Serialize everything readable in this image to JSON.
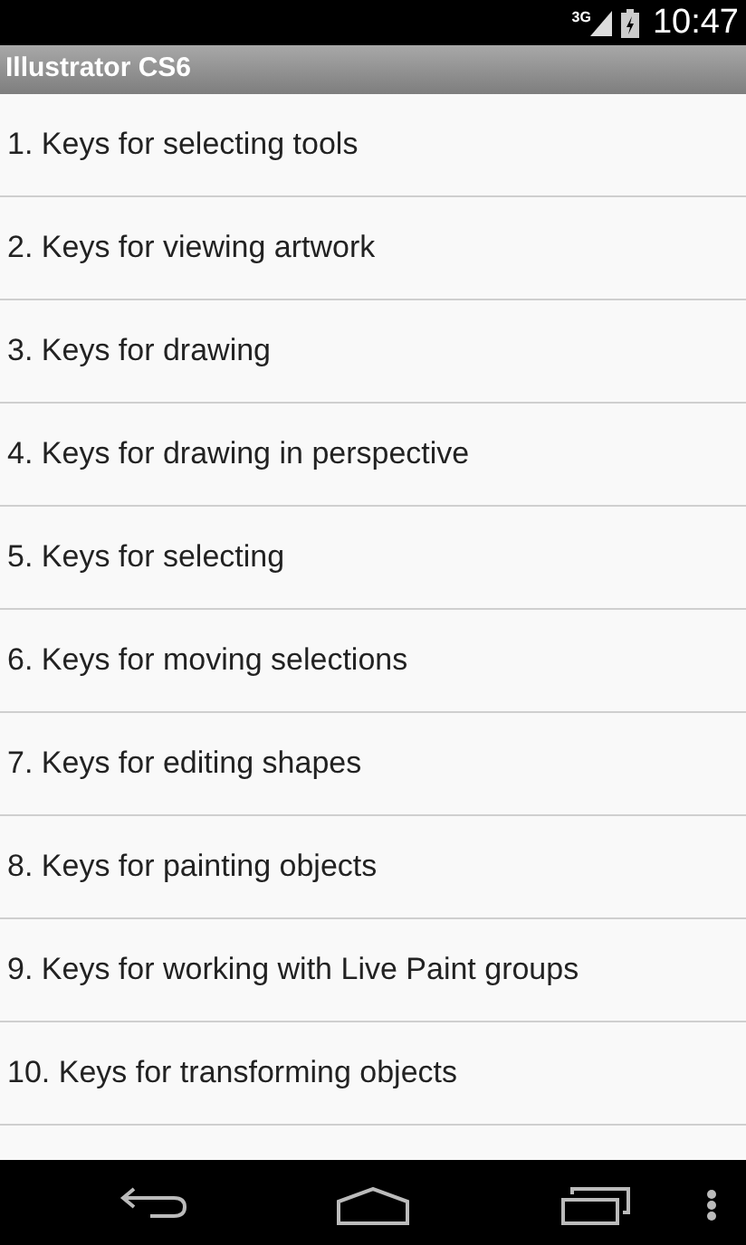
{
  "status_bar": {
    "network": "3G",
    "time": "10:47"
  },
  "title": "Illustrator CS6",
  "items": [
    {
      "label": "1. Keys for selecting tools"
    },
    {
      "label": "2. Keys for viewing artwork"
    },
    {
      "label": "3. Keys for drawing"
    },
    {
      "label": "4. Keys for drawing in perspective"
    },
    {
      "label": "5. Keys for selecting"
    },
    {
      "label": "6. Keys for moving selections"
    },
    {
      "label": "7. Keys for editing shapes"
    },
    {
      "label": "8. Keys for painting objects"
    },
    {
      "label": "9. Keys for working with Live Paint groups"
    },
    {
      "label": "10. Keys for transforming objects"
    }
  ]
}
